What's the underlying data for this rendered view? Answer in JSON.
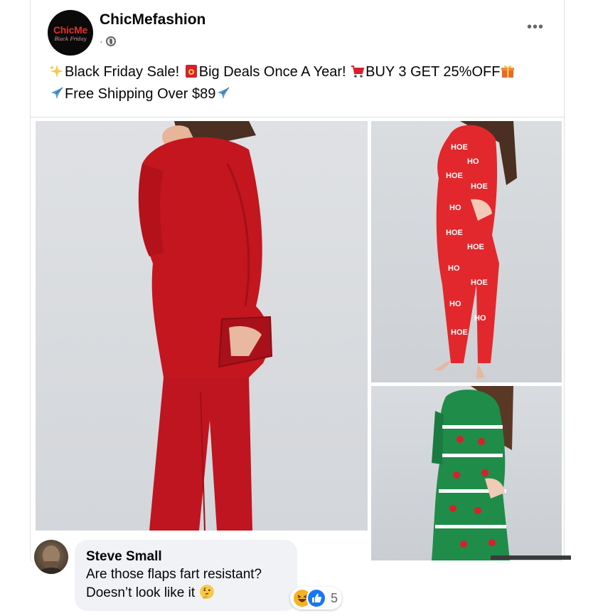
{
  "post": {
    "avatar": {
      "brand": "ChicMe",
      "tagline": "Black Friday"
    },
    "page_name": "ChicMefashion",
    "meta_separator": "·",
    "privacy_icon": "globe-icon",
    "more_icon": "more-options-icon",
    "more_label": "•••",
    "caption": {
      "line1": [
        {
          "emoji": "sparkles-icon"
        },
        {
          "text": "Black Friday Sale! "
        },
        {
          "emoji": "red-envelope-icon"
        },
        {
          "text": "Big Deals Once A Year! "
        },
        {
          "emoji": "shopping-cart-icon"
        },
        {
          "text": "BUY 3 GET 25%OFF"
        },
        {
          "emoji": "gift-icon"
        }
      ],
      "line2": [
        {
          "emoji": "airplane-icon"
        },
        {
          "text": "Free Shipping Over $89"
        },
        {
          "emoji": "airplane-icon"
        }
      ]
    },
    "images": [
      {
        "name": "red-onesie-photo",
        "colors": [
          "#b8141e",
          "#d11f2a"
        ]
      },
      {
        "name": "hoho-print-onesie-photo",
        "colors": [
          "#e2282c",
          "#ffffff"
        ]
      },
      {
        "name": "green-christmas-onesie-photo",
        "colors": [
          "#1f8c4a",
          "#d9202a"
        ]
      }
    ]
  },
  "comment": {
    "author": "Steve Small",
    "text_line1": "Are those flaps fart resistant?",
    "text_line2": "Doesn’t look like it",
    "text_emoji": "thinking-face-icon",
    "reactions": {
      "icons": [
        "haha-reaction-icon",
        "like-reaction-icon"
      ],
      "count": "5"
    }
  },
  "colors": {
    "background": "#ffffff",
    "bubble": "#f0f2f5",
    "secondary_text": "#65676b",
    "like_blue": "#1877f2",
    "haha_yellow": "#f7b125",
    "brand_red": "#e0312b"
  }
}
